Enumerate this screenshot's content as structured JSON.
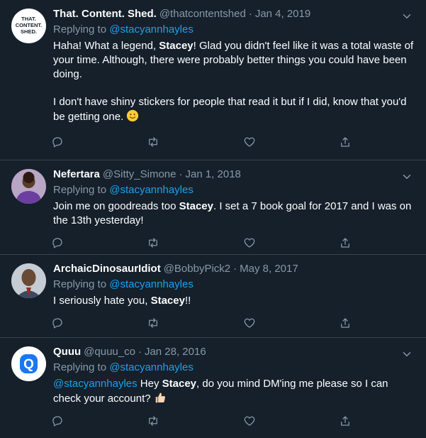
{
  "replying_to_label": "Replying to",
  "tweets": [
    {
      "name": "That. Content. Shed.",
      "handle": "@thatcontentshed",
      "sep": "·",
      "date": "Jan 4, 2019",
      "reply_to": "@stacyannhayles",
      "avatar_text": [
        "THAT.",
        "CONTENT.",
        "SHED."
      ],
      "p1_a": "Haha! What a legend, ",
      "p1_b": "Stacey",
      "p1_c": "! Glad you didn't feel like it was a total waste of your time. Although, there were probably better things you could have been doing.",
      "p2": "I don't have shiny stickers for people that read it but if I did, know that you'd be getting one.",
      "emoji": "slightly-smiling-face"
    },
    {
      "name": "Nefertara",
      "handle": "@Sitty_Simone",
      "sep": "·",
      "date": "Jan 1, 2018",
      "reply_to": "@stacyannhayles",
      "t_a": "Join me on goodreads too ",
      "t_b": "Stacey",
      "t_c": ". I set a 7 book goal for 2017 and I was on the 13th yesterday!"
    },
    {
      "name": "ArchaicDinosaurIdiot",
      "handle": "@BobbyPick2",
      "sep": "·",
      "date": "May 8, 2017",
      "reply_to": "@stacyannhayles",
      "t_a": "I seriously hate you, ",
      "t_b": "Stacey",
      "t_c": "!!"
    },
    {
      "name": "Quuu",
      "handle": "@quuu_co",
      "sep": "·",
      "date": "Jan 28, 2016",
      "reply_to": "@stacyannhayles",
      "avatar_text": "Q",
      "t_mention": "@stacyannhayles",
      "t_a": " Hey ",
      "t_b": "Stacey",
      "t_c": ", do you mind DM'ing me please so I can check your account?",
      "emoji": "thumbs-up"
    }
  ],
  "colors": {
    "background": "#15202b",
    "divider": "#38444d",
    "secondary_text": "#8899a6",
    "link": "#1da1f2",
    "quuu_blue": "#1877f2"
  },
  "icons": [
    "reply-icon",
    "retweet-icon",
    "like-icon",
    "share-icon",
    "chevron-down-icon"
  ]
}
